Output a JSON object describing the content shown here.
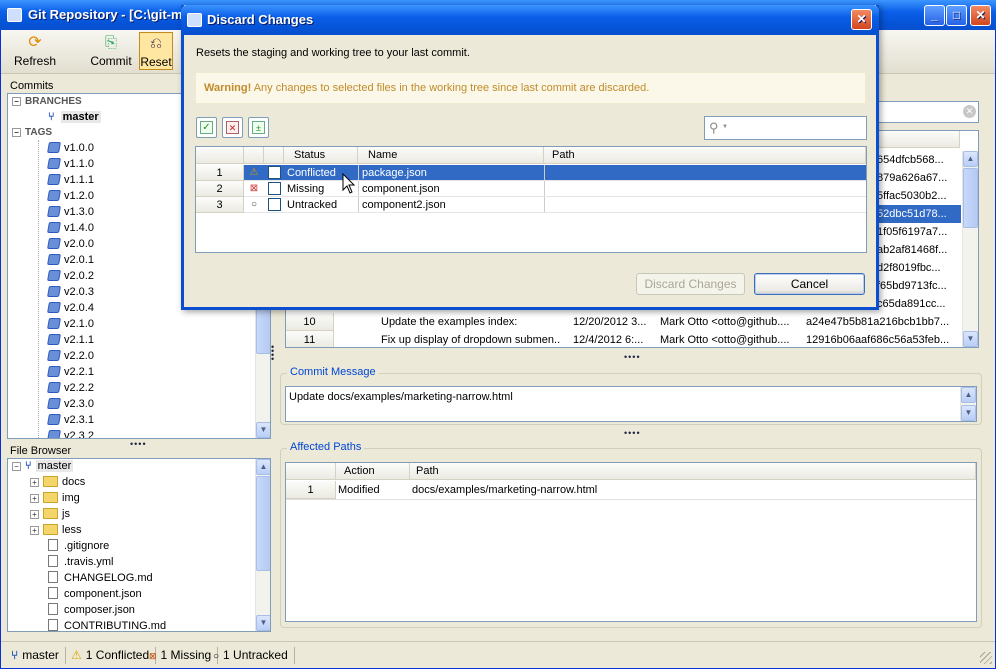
{
  "window": {
    "title": "Git Repository - [C:\\git-m"
  },
  "toolbar": {
    "refresh": "Refresh",
    "commit": "Commit",
    "reset": "Reset"
  },
  "commits_panel": {
    "title": "Commits",
    "branches_label": "BRANCHES",
    "branch": "master",
    "tags_label": "TAGS",
    "tags": [
      "v1.0.0",
      "v1.1.0",
      "v1.1.1",
      "v1.2.0",
      "v1.3.0",
      "v1.4.0",
      "v2.0.0",
      "v2.0.1",
      "v2.0.2",
      "v2.0.3",
      "v2.0.4",
      "v2.1.0",
      "v2.1.1",
      "v2.2.0",
      "v2.2.1",
      "v2.2.2",
      "v2.3.0",
      "v2.3.1",
      "v2.3.2"
    ]
  },
  "file_browser": {
    "title": "File Browser",
    "root": "master",
    "folders": [
      "docs",
      "img",
      "js",
      "less"
    ],
    "files": [
      ".gitignore",
      ".travis.yml",
      "CHANGELOG.md",
      "component.json",
      "composer.json",
      "CONTRIBUTING.md"
    ]
  },
  "commit_table": {
    "hashes_partial": [
      "654dfcb568...",
      "879a626a67...",
      "5ffac5030b2...",
      "52dbc51d78...",
      "1f05f6197a7...",
      "ab2af81468f...",
      "d2f8019fbc...",
      "f65bd9713fc...",
      "c65da891cc..."
    ],
    "rows": [
      {
        "num": "10",
        "message": "Update the examples index:",
        "date": "12/20/2012 3...",
        "author": "Mark Otto <otto@github....",
        "hash": "a24e47b5b81a216bcb1bb7..."
      },
      {
        "num": "11",
        "message": "Fix up display of dropdown submen...",
        "date": "12/4/2012 6:...",
        "author": "Mark Otto <otto@github....",
        "hash": "12916b06aaf686c56a53feb..."
      }
    ]
  },
  "commit_message": {
    "title": "Commit Message",
    "text": "Update docs/examples/marketing-narrow.html"
  },
  "affected_paths": {
    "title": "Affected Paths",
    "headers": {
      "action": "Action",
      "path": "Path"
    },
    "rows": [
      {
        "num": "1",
        "action": "Modified",
        "path": "docs/examples/marketing-narrow.html"
      }
    ]
  },
  "dialog": {
    "title": "Discard Changes",
    "description": "Resets the staging and working tree to your last commit.",
    "warning_bold": "Warning!",
    "warning_text": " Any changes to selected files in the working tree since last commit are discarded.",
    "search_placeholder": "",
    "headers": {
      "status": "Status",
      "name": "Name",
      "path": "Path"
    },
    "rows": [
      {
        "num": "1",
        "status": "Conflicted",
        "name": "package.json",
        "path": "",
        "selected": true
      },
      {
        "num": "2",
        "status": "Missing",
        "name": "component.json",
        "path": "",
        "selected": false
      },
      {
        "num": "3",
        "status": "Untracked",
        "name": "component2.json",
        "path": "",
        "selected": false
      }
    ],
    "discard_button": "Discard Changes",
    "cancel_button": "Cancel"
  },
  "statusbar": {
    "branch": "master",
    "conflicted": "1 Conflicted",
    "missing": "1 Missing",
    "untracked": "1 Untracked"
  },
  "colors": {
    "selection": "#316ac5",
    "warning_text": "#c08b2b",
    "group_title": "#0046d5",
    "titlebar": "#0a5fe8"
  }
}
